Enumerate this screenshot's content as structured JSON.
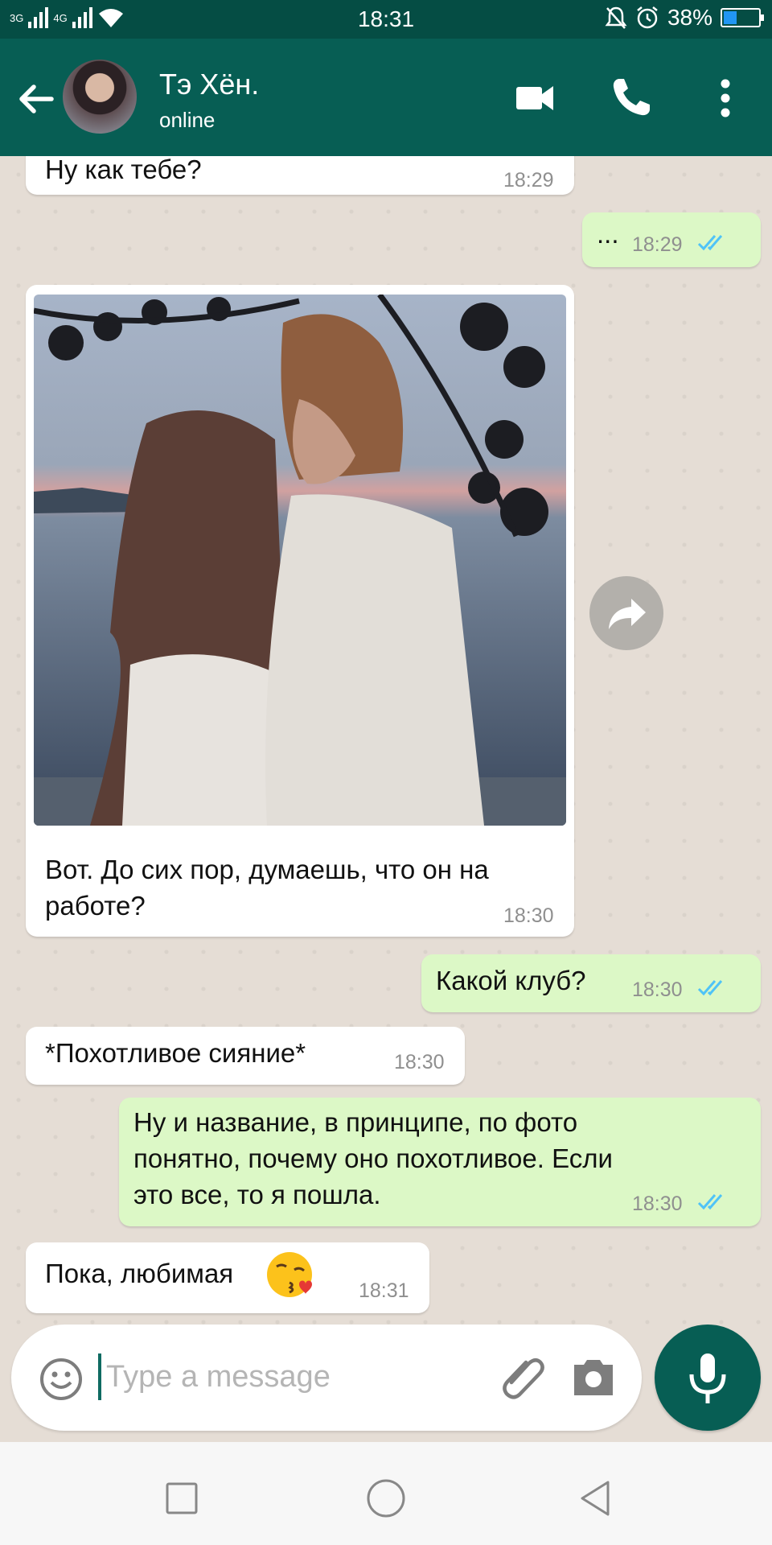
{
  "status_bar": {
    "network_1": "3G",
    "network_2": "4G",
    "time": "18:31",
    "battery": "38%",
    "battery_level": 0.38,
    "icons": [
      "signal-icon",
      "wifi-icon",
      "mute-icon",
      "alarm-icon",
      "battery-icon"
    ]
  },
  "header": {
    "contact_name": "Тэ Хён.",
    "status": "online",
    "icons": [
      "back-arrow-icon",
      "video-call-icon",
      "phone-icon",
      "more-vert-icon"
    ]
  },
  "messages": [
    {
      "direction": "incoming",
      "text": "Ну как тебе?",
      "time": "18:29"
    },
    {
      "direction": "outgoing",
      "text": "...",
      "time": "18:29",
      "read": true
    },
    {
      "direction": "incoming",
      "type": "image",
      "text_lines": [
        "Вот. До сих пор, думаешь, что он на",
        "работе?"
      ],
      "time": "18:30"
    },
    {
      "direction": "outgoing",
      "text": "Какой клуб?",
      "time": "18:30",
      "read": true
    },
    {
      "direction": "incoming",
      "text": "*Похотливое сияние*",
      "time": "18:30"
    },
    {
      "direction": "outgoing",
      "text_lines": [
        "Ну и название, в принципе, по фото",
        "понятно, почему оно похотливое. Если",
        "это все, то я пошла."
      ],
      "time": "18:30",
      "read": true
    },
    {
      "direction": "incoming",
      "text": "Пока, любимая",
      "emoji": "kissing-face-heart",
      "time": "18:31"
    }
  ],
  "composer": {
    "placeholder": "Type a message",
    "value": "",
    "icons": [
      "emoji-icon",
      "attach-icon",
      "camera-icon",
      "mic-icon"
    ]
  },
  "colors": {
    "header": "#075e54",
    "status_bar": "#054d44",
    "incoming_bubble": "#ffffff",
    "outgoing_bubble": "#dcf8c6",
    "chat_background": "#e5ddd5",
    "read_ticks": "#4fc3f7"
  }
}
